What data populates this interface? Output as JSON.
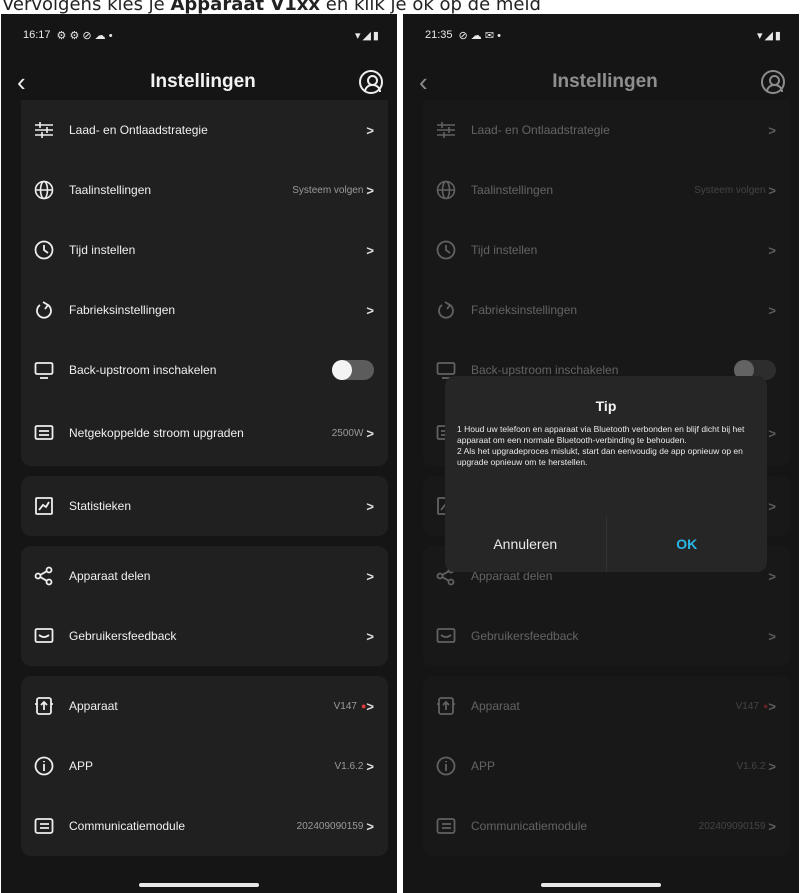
{
  "caption": {
    "prefix": "Vervolgens kies je ",
    "bold": "Apparaat V1xx",
    "suffix": " en klik je ok op de meld"
  },
  "left": {
    "status_time": "16:17",
    "status_icons": "⚙ ⚙ ⊘ ☁ •",
    "status_right": "▾◢▮"
  },
  "right": {
    "status_time": "21:35",
    "status_icons": "⊘ ☁ ✉ •",
    "status_right": "▾◢▮"
  },
  "header": {
    "title": "Instellingen"
  },
  "groups": [
    [
      {
        "icon": "sliders-icon",
        "label": "Laad- en Ontlaadstrategie",
        "value": ""
      },
      {
        "icon": "globe-icon",
        "label": "Taalinstellingen",
        "value": "Systeem volgen"
      },
      {
        "icon": "clock-icon",
        "label": "Tijd instellen",
        "value": ""
      },
      {
        "icon": "reset-icon",
        "label": "Fabrieksinstellingen",
        "value": ""
      },
      {
        "icon": "monitor-icon",
        "label": "Back-upstroom inschakelen",
        "value": ""
      },
      {
        "icon": "grid-power-icon",
        "label": "Netgekoppelde stroom upgraden",
        "value": "2500W"
      }
    ],
    [
      {
        "icon": "chart-icon",
        "label": "Statistieken",
        "value": ""
      }
    ],
    [
      {
        "icon": "share-icon",
        "label": "Apparaat delen",
        "value": ""
      },
      {
        "icon": "feedback-icon",
        "label": "Gebruikersfeedback",
        "value": ""
      }
    ],
    [
      {
        "icon": "device-icon",
        "label": "Apparaat",
        "value": "V147"
      },
      {
        "icon": "info-icon",
        "label": "APP",
        "value": "V1.6.2"
      },
      {
        "icon": "module-icon",
        "label": "Communicatiemodule",
        "value": "202409090159"
      }
    ]
  ],
  "toggle": {
    "enabled": false
  },
  "dialog": {
    "title": "Tip",
    "body_1": "1 Houd uw telefoon en apparaat via Bluetooth verbonden en blijf dicht bij het apparaat om een normale Bluetooth-verbinding te behouden.",
    "body_2": "2 Als het upgradeproces mislukt, start dan eenvoudig de app opnieuw op en upgrade opnieuw om te herstellen.",
    "cancel_label": "Annuleren",
    "ok_label": "OK"
  },
  "colors": {
    "background": "#151515",
    "card": "#202020",
    "accent": "#29b6e8",
    "badge": "#e23a3a"
  }
}
